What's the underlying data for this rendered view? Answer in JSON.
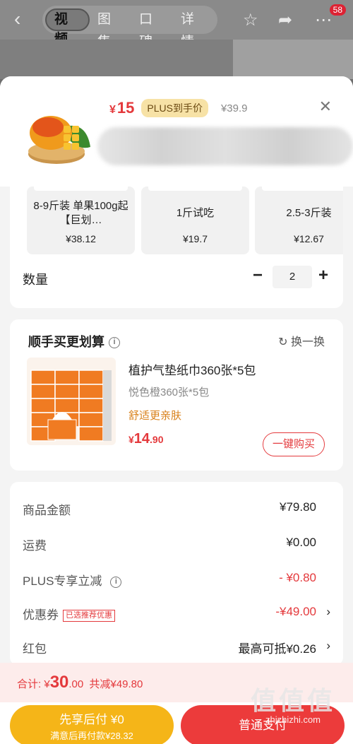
{
  "topbar": {
    "tabs": [
      "视频",
      "图集",
      "口碑",
      "详情"
    ],
    "badge": "58"
  },
  "product": {
    "price_currency": "¥",
    "price_now": "15",
    "plus_label": "PLUS到手价",
    "price_old": "¥39.9"
  },
  "specs": [
    {
      "name": "8-9斤装 单果100g起【巨划…",
      "price": "¥38.12"
    },
    {
      "name": "1斤试吃",
      "price": "¥19.7"
    },
    {
      "name": "2.5-3斤装",
      "price": "¥12.67"
    }
  ],
  "quantity": {
    "label": "数量",
    "minus": "−",
    "value": "2",
    "plus": "+"
  },
  "addon": {
    "title": "顺手买更划算",
    "info": "i",
    "refresh": "换一换",
    "name": "植护气垫纸巾360张*5包",
    "variant": "悦色橙360张*5包",
    "tag": "舒适更亲肤",
    "price_currency": "¥",
    "price_int": "14",
    "price_dec": ".90",
    "buy_label": "一键购买"
  },
  "summary": {
    "rows": [
      {
        "label": "商品金额",
        "value": "¥79.80"
      },
      {
        "label": "运费",
        "value": "¥0.00"
      },
      {
        "label": "PLUS专享立减",
        "value": "- ¥0.80"
      },
      {
        "label": "优惠券",
        "tag": "已选推荐优惠",
        "value": "-¥49.00"
      },
      {
        "label": "红包",
        "value": "最高可抵¥0.26"
      }
    ]
  },
  "total": {
    "prefix": "合计: ¥",
    "int": "30",
    "dec": ".00",
    "saved": "共减¥49.80"
  },
  "buttons": {
    "pay_later_line1": "先享后付 ¥0",
    "pay_later_line2": "满意后再付款¥28.32",
    "pay_normal": "普通支付"
  },
  "watermark": {
    "line1": "值值值",
    "line2": "zhizhizhi.com"
  },
  "colors": {
    "accent_red": "#e4393c",
    "plus_gold": "#f7e2a6",
    "pay_later": "#f5b518",
    "pay_normal": "#ec3b3b"
  }
}
